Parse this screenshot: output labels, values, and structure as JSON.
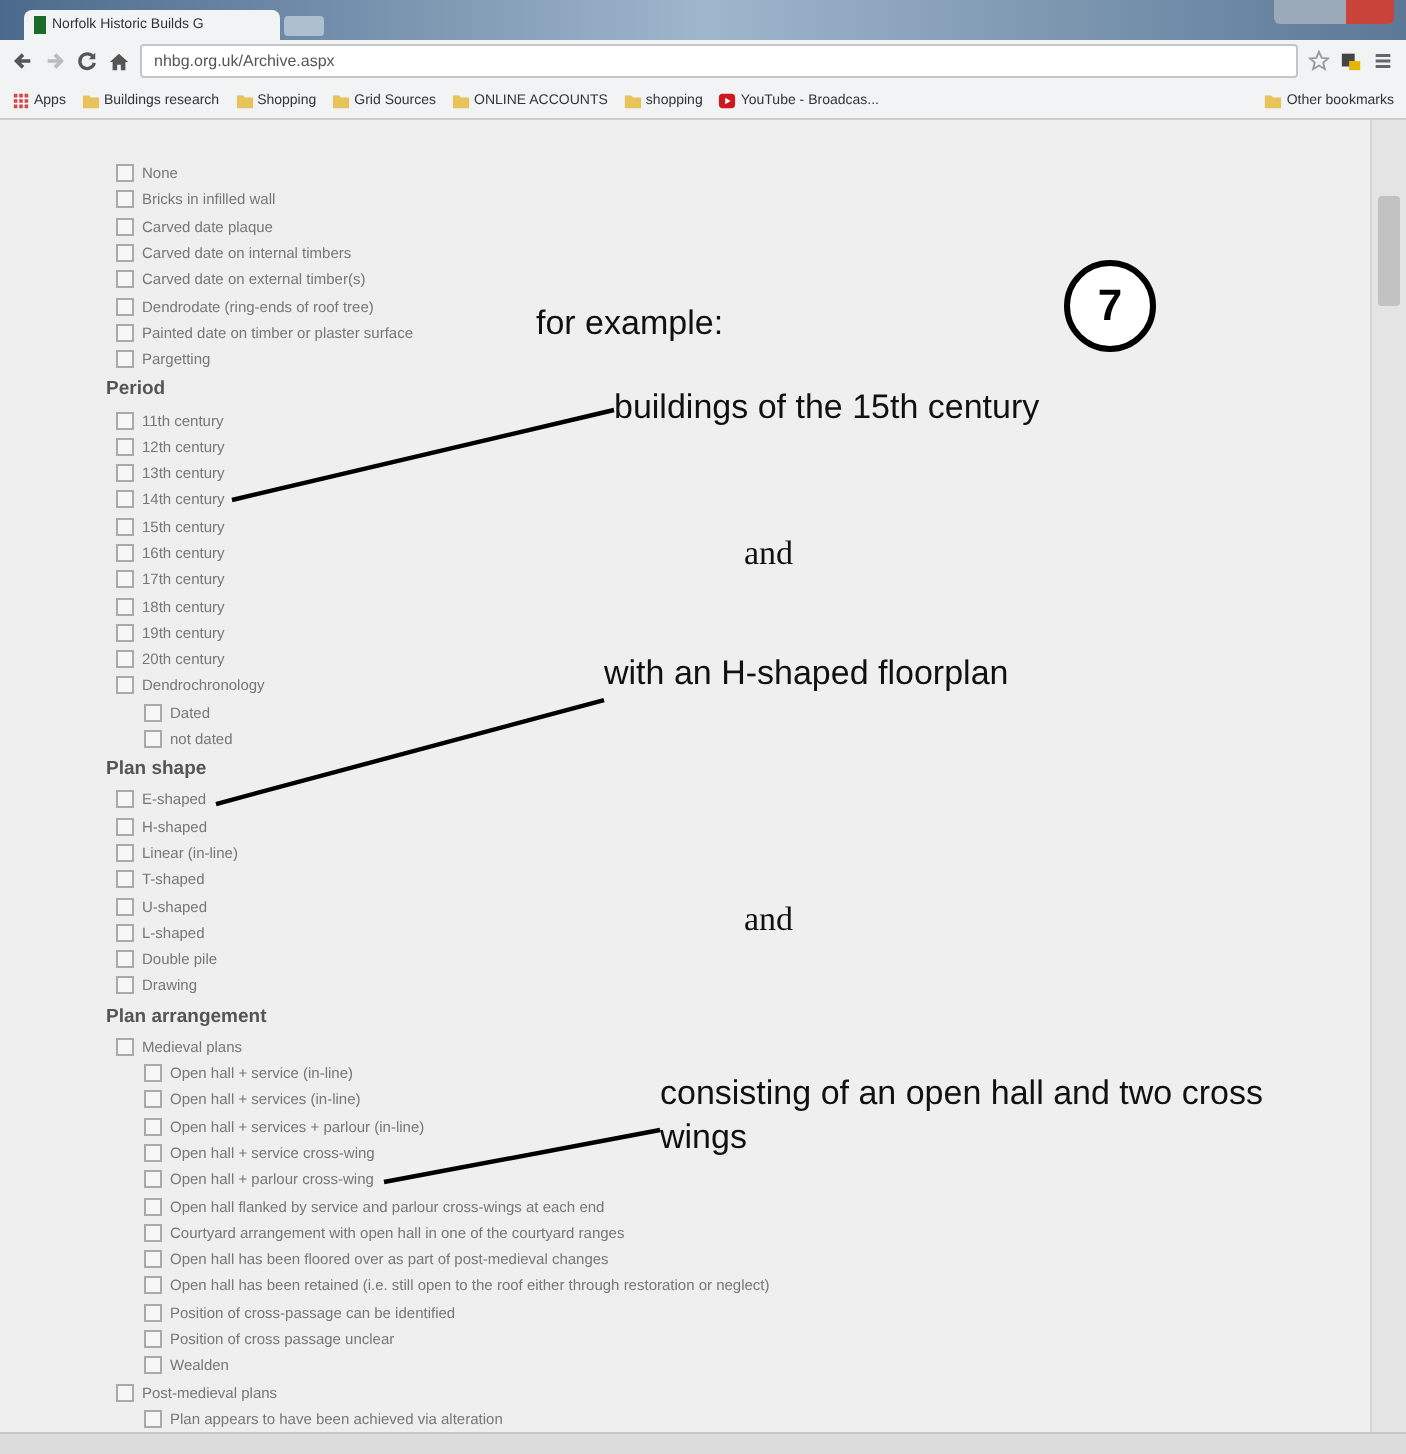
{
  "browser": {
    "tabs": [
      {
        "title": "Norfolk Historic Builds G",
        "selected": true
      }
    ],
    "url": "nhbg.org.uk/Archive.aspx",
    "bookmarks": [
      {
        "label": "Apps",
        "kind": "apps"
      },
      {
        "label": "Buildings research",
        "kind": "folder"
      },
      {
        "label": "Shopping",
        "kind": "folder"
      },
      {
        "label": "Grid Sources",
        "kind": "folder"
      },
      {
        "label": "ONLINE ACCOUNTS",
        "kind": "folder"
      },
      {
        "label": "shopping",
        "kind": "folder"
      },
      {
        "label": "YouTube - Broadcas...",
        "kind": "video"
      },
      {
        "label": "Other bookmarks",
        "kind": "folder"
      }
    ]
  },
  "page": {
    "sections": [
      {
        "items": [
          {
            "label": "None",
            "checked": false
          },
          {
            "label": "Bricks in infilled wall",
            "checked": false
          },
          {
            "label": "Carved date plaque",
            "checked": false
          },
          {
            "label": "Carved date on internal timbers",
            "checked": false
          },
          {
            "label": "Carved date on external timber(s)",
            "checked": false
          },
          {
            "label": "Dendrodate (ring-ends of roof tree)",
            "checked": false
          },
          {
            "label": "Painted date on timber or plaster surface",
            "checked": false
          },
          {
            "label": "Pargetting",
            "checked": false
          }
        ]
      },
      {
        "heading": "Period",
        "items": [
          {
            "label": "11th century",
            "checked": false
          },
          {
            "label": "12th century",
            "checked": false
          },
          {
            "label": "13th century",
            "checked": false
          },
          {
            "label": "14th century",
            "checked": false
          },
          {
            "label": "15th century",
            "checked": false
          },
          {
            "label": "16th century",
            "checked": false
          },
          {
            "label": "17th century",
            "checked": false
          },
          {
            "label": "18th century",
            "checked": false
          },
          {
            "label": "19th century",
            "checked": false
          },
          {
            "label": "20th century",
            "checked": false
          },
          {
            "label": "Dendrochronology",
            "checked": false,
            "children": [
              {
                "label": "Dated",
                "checked": false
              },
              {
                "label": "not dated",
                "checked": false
              }
            ]
          }
        ]
      },
      {
        "heading": "Plan shape",
        "items": [
          {
            "label": "E-shaped",
            "checked": false
          },
          {
            "label": "H-shaped",
            "checked": false
          },
          {
            "label": "Linear (in-line)",
            "checked": false
          },
          {
            "label": "T-shaped",
            "checked": false
          },
          {
            "label": "U-shaped",
            "checked": false
          },
          {
            "label": "L-shaped",
            "checked": false
          },
          {
            "label": "Double pile",
            "checked": false
          },
          {
            "label": "Drawing",
            "checked": false
          }
        ]
      },
      {
        "heading": "Plan arrangement",
        "items": [
          {
            "label": "Medieval plans",
            "checked": false,
            "children": [
              {
                "label": "Open hall + service (in-line)",
                "checked": false
              },
              {
                "label": "Open hall + services (in-line)",
                "checked": false
              },
              {
                "label": "Open hall + services + parlour (in-line)",
                "checked": false
              },
              {
                "label": "Open hall + service cross-wing",
                "checked": false
              },
              {
                "label": "Open hall + parlour cross-wing",
                "checked": false
              },
              {
                "label": "Open hall flanked by service and parlour cross-wings at each end",
                "checked": false
              },
              {
                "label": "Courtyard arrangement with open hall in one of the courtyard ranges",
                "checked": false
              },
              {
                "label": "Open hall has been floored over as part of post-medieval changes",
                "checked": false
              },
              {
                "label": "Open hall has been retained (i.e. still open to the roof either through restoration or neglect)",
                "checked": false
              },
              {
                "label": "Position of cross-passage can be identified",
                "checked": false
              },
              {
                "label": "Position of cross passage unclear",
                "checked": false
              },
              {
                "label": "Wealden",
                "checked": false
              }
            ]
          },
          {
            "label": "Post-medieval plans",
            "checked": false,
            "children": [
              {
                "label": "Plan appears to have been achieved via alteration",
                "checked": false
              }
            ]
          }
        ]
      }
    ]
  },
  "annotations": {
    "intro": "for example:",
    "step": "7",
    "notes": [
      {
        "kind": "callout",
        "text": "buildings of the 15th century"
      },
      {
        "kind": "conjunction",
        "text": "and"
      },
      {
        "kind": "callout",
        "text": "with an H-shaped floorplan"
      },
      {
        "kind": "conjunction",
        "text": "and"
      },
      {
        "kind": "callout",
        "text": "consisting of an open hall and two cross wings"
      }
    ]
  }
}
